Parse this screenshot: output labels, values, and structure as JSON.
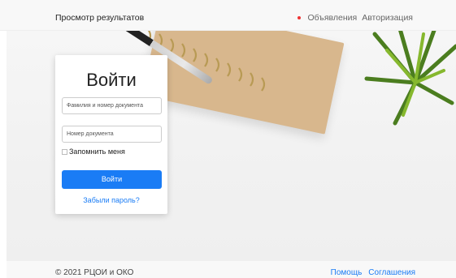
{
  "header": {
    "title": "Просмотр результатов",
    "nav": [
      {
        "label": "Объявления",
        "has_dot": true
      },
      {
        "label": "Авторизация"
      }
    ]
  },
  "login": {
    "title": "Войти",
    "field1_placeholder": "Фамилия и номер документа",
    "field2_placeholder": "Номер документа",
    "remember_label": "Запомнить меня",
    "button_label": "Войти",
    "forgot_label": "Забыли пароль?"
  },
  "footer": {
    "copyright": "© 2021 РЦОИ и ОКО",
    "links": [
      "Помощь",
      "Соглашения"
    ]
  },
  "colors": {
    "accent": "#1a7cf5",
    "dot": "#e33333"
  }
}
